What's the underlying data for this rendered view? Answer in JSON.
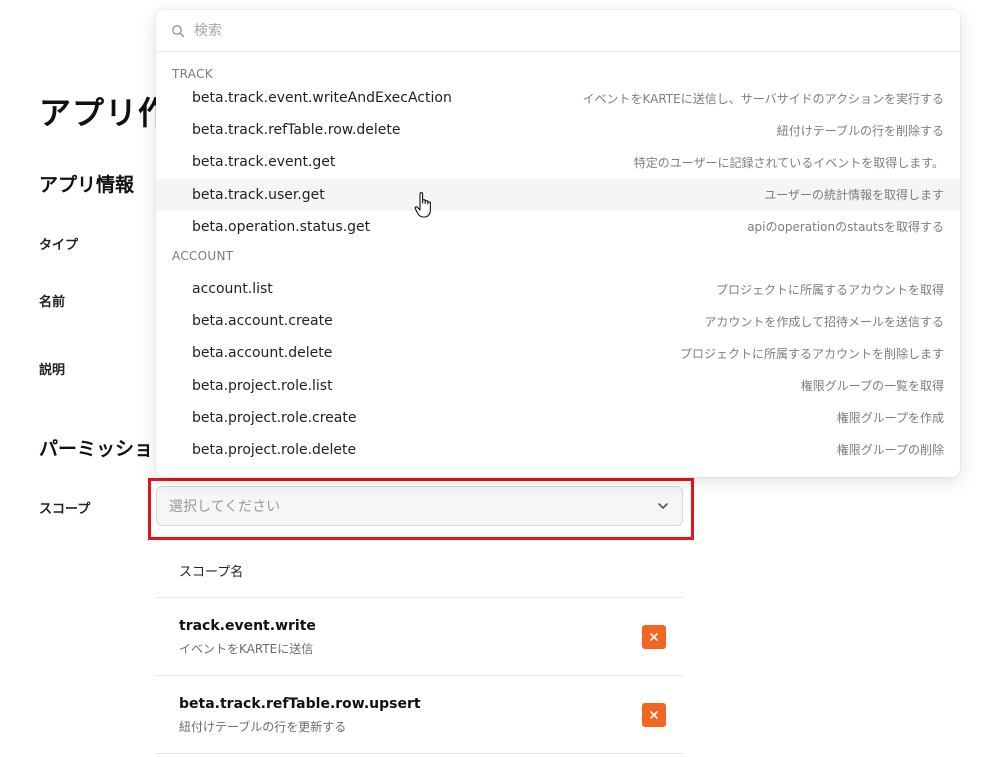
{
  "page": {
    "title": "アプリ作",
    "section_app_info": "アプリ情報",
    "label_type": "タイプ",
    "label_name": "名前",
    "label_description": "説明",
    "section_permissions": "パーミッショ",
    "label_scope": "スコープ"
  },
  "scope_select": {
    "placeholder": "選択してください",
    "icon": "chevron-down-icon"
  },
  "scope_table": {
    "header": "スコープ名",
    "rows": [
      {
        "name": "track.event.write",
        "description": "イベントをKARTEに送信",
        "remove_icon": "close-icon"
      },
      {
        "name": "beta.track.refTable.row.upsert",
        "description": "紐付けテーブルの行を更新する",
        "remove_icon": "close-icon"
      }
    ]
  },
  "dropdown": {
    "search_placeholder": "検索",
    "search_icon": "search-icon",
    "groups": [
      {
        "label": "TRACK",
        "items": [
          {
            "name": "beta.track.event.writeAndExecAction",
            "description": "イベントをKARTEに送信し、サーバサイドのアクションを実行する"
          },
          {
            "name": "beta.track.refTable.row.delete",
            "description": "紐付けテーブルの行を削除する"
          },
          {
            "name": "beta.track.event.get",
            "description": "特定のユーザーに記録されているイベントを取得します。"
          },
          {
            "name": "beta.track.user.get",
            "description": "ユーザーの統計情報を取得します"
          },
          {
            "name": "beta.operation.status.get",
            "description": "apiのoperationのstautsを取得する"
          }
        ]
      },
      {
        "label": "ACCOUNT",
        "items": [
          {
            "name": "account.list",
            "description": "プロジェクトに所属するアカウントを取得"
          },
          {
            "name": "beta.account.create",
            "description": "アカウントを作成して招待メールを送信する"
          },
          {
            "name": "beta.account.delete",
            "description": "プロジェクトに所属するアカウントを削除します"
          },
          {
            "name": "beta.project.role.list",
            "description": "権限グループの一覧を取得"
          },
          {
            "name": "beta.project.role.create",
            "description": "権限グループを作成"
          },
          {
            "name": "beta.project.role.delete",
            "description": "権限グループの削除"
          }
        ]
      }
    ]
  },
  "colors": {
    "highlight": "#e5141c",
    "remove_button": "#f26522"
  }
}
